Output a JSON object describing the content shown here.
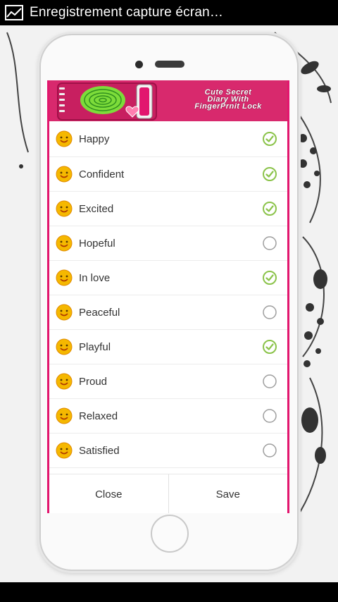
{
  "status_bar": {
    "notification_icon": "image-graph-icon",
    "notification_text": "Enregistrement capture écran…"
  },
  "banner": {
    "title": "Cute Secret\nDiary With\nFingerPrnit Lock",
    "background_color": "#d8296d"
  },
  "moods": [
    {
      "label": "Happy",
      "emoji": "grinning-face-icon",
      "checked": true
    },
    {
      "label": "Confident",
      "emoji": "smiling-cat-horns-icon",
      "checked": true
    },
    {
      "label": "Excited",
      "emoji": "grinning-face-icon",
      "checked": true
    },
    {
      "label": "Hopeful",
      "emoji": "crossed-fingers-face-icon",
      "checked": false
    },
    {
      "label": "In love",
      "emoji": "heart-face-icon",
      "checked": true
    },
    {
      "label": "Peaceful",
      "emoji": "halo-face-icon",
      "checked": false
    },
    {
      "label": "Playful",
      "emoji": "sunglasses-face-icon",
      "checked": true
    },
    {
      "label": "Proud",
      "emoji": "proud-face-icon",
      "checked": false
    },
    {
      "label": "Relaxed",
      "emoji": "relaxed-face-icon",
      "checked": false
    },
    {
      "label": "Satisfied",
      "emoji": "satisfied-face-icon",
      "checked": false
    }
  ],
  "footer": {
    "close_label": "Close",
    "save_label": "Save"
  },
  "colors": {
    "check_green": "#8bc34a",
    "unchecked_gray": "#9e9e9e",
    "emoji_yellow": "#f5b800",
    "accent_pink": "#e2166e"
  }
}
